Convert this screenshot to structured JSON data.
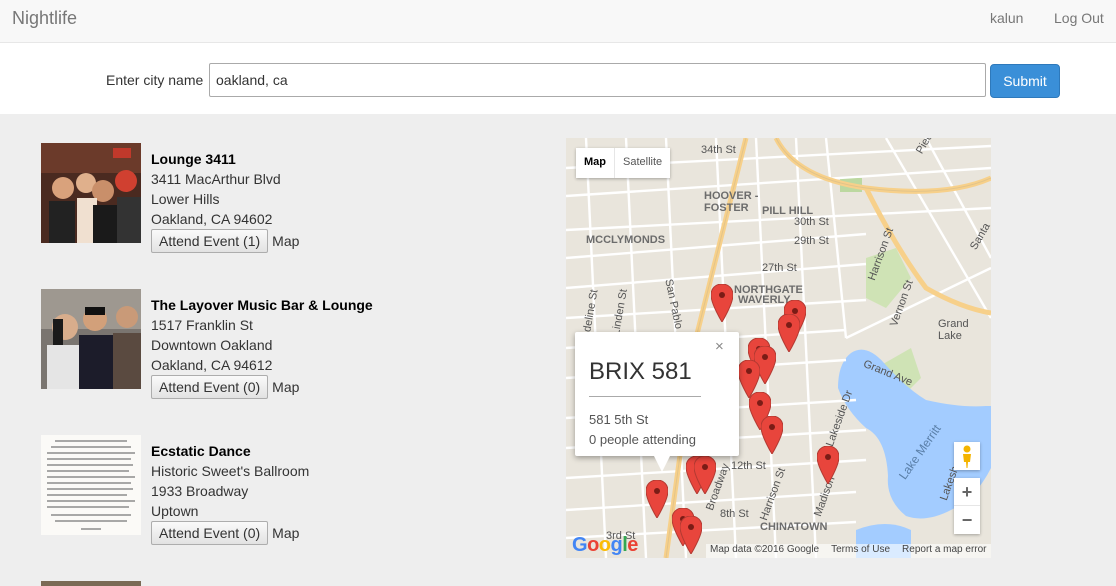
{
  "navbar": {
    "brand": "Nightlife",
    "user": "kalun",
    "logout": "Log Out"
  },
  "search": {
    "label": "Enter city name",
    "value": "oakland, ca",
    "submit": "Submit"
  },
  "bars": [
    {
      "name": "Lounge 3411",
      "line1": "3411 MacArthur Blvd",
      "line2": "Lower Hills",
      "line3": "Oakland, CA 94602",
      "attend": "Attend Event (1)",
      "map": "Map"
    },
    {
      "name": "The Layover Music Bar & Lounge",
      "line1": "1517 Franklin St",
      "line2": "Downtown Oakland",
      "line3": "Oakland, CA 94612",
      "attend": "Attend Event (0)",
      "map": "Map"
    },
    {
      "name": "Ecstatic Dance",
      "line1": "Historic Sweet's Ballroom",
      "line2": "1933 Broadway",
      "line3": "Uptown",
      "attend": "Attend Event (0)",
      "map": "Map"
    }
  ],
  "map": {
    "type_map": "Map",
    "type_satellite": "Satellite",
    "google": "Google",
    "attribution": [
      "Map data ©2016 Google",
      "Terms of Use",
      "Report a map error"
    ],
    "zoom_in": "+",
    "zoom_out": "−",
    "labels": [
      "34th St",
      "HOOVER - FOSTER",
      "PILL HILL",
      "30th St",
      "29th St",
      "MCCLYMONDS",
      "27th St",
      "NORTHGATE",
      "WAVERLY",
      "San Pablo Ave",
      "Harrison St",
      "Vernon St",
      "Grand Lake",
      "Grand Ave",
      "Lakeside Dr",
      "Lake Merritt",
      "Lakeshore",
      "Broadway",
      "12th St",
      "Harrison St",
      "8th St",
      "Madison",
      "CHINATOWN",
      "3rd St",
      "Piedm",
      "Santa",
      "Adeline St",
      "Linden St"
    ],
    "infowindow": {
      "title": "BRIX 581",
      "address": "581 5th St",
      "attending": "0 people attending",
      "close": "×"
    },
    "colors": {
      "pin": "#e8453c",
      "water": "#a3ccff",
      "park": "#c9dfaf",
      "road": "#ffffff",
      "highway": "#f7d08a"
    }
  }
}
